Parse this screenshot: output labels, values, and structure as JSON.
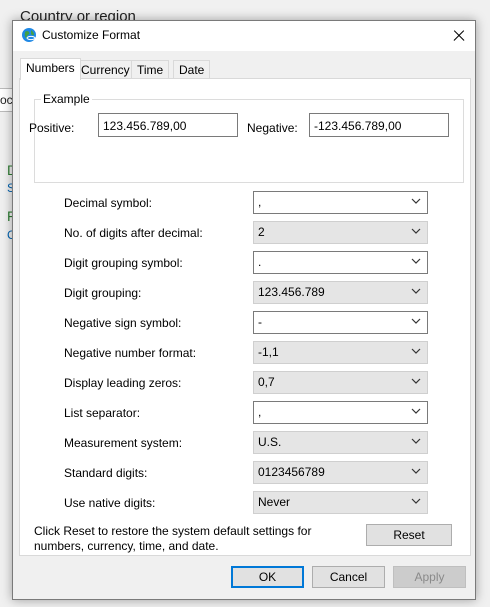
{
  "background": {
    "title": "Country or region",
    "strip_text": "oc",
    "green_1": "D",
    "blue_1": "S",
    "green_2": "F",
    "blue_2": "C"
  },
  "dialog": {
    "title": "Customize Format",
    "tabs": [
      {
        "label": "Numbers"
      },
      {
        "label": "Currency"
      },
      {
        "label": "Time"
      },
      {
        "label": "Date"
      }
    ],
    "example": {
      "group_label": "Example",
      "positive_label": "Positive:",
      "positive_value": "123.456.789,00",
      "negative_label": "Negative:",
      "negative_value": "-123.456.789,00"
    },
    "settings": [
      {
        "label": "Decimal symbol:",
        "value": ","
      },
      {
        "label": "No. of digits after decimal:",
        "value": "2"
      },
      {
        "label": "Digit grouping symbol:",
        "value": "."
      },
      {
        "label": "Digit grouping:",
        "value": "123.456.789"
      },
      {
        "label": "Negative sign symbol:",
        "value": "-"
      },
      {
        "label": "Negative number format:",
        "value": "-1,1"
      },
      {
        "label": "Display leading zeros:",
        "value": "0,7"
      },
      {
        "label": "List separator:",
        "value": ","
      },
      {
        "label": "Measurement system:",
        "value": "U.S."
      },
      {
        "label": "Standard digits:",
        "value": "0123456789"
      },
      {
        "label": "Use native digits:",
        "value": "Never"
      }
    ],
    "info_text": "Click Reset to restore the system default settings for numbers, currency, time, and date.",
    "reset_label": "Reset",
    "ok_label": "OK",
    "cancel_label": "Cancel",
    "apply_label": "Apply"
  },
  "colors": {
    "accent": "#0078d7",
    "icon_blue": "#1e88e5",
    "icon_green": "#43a047"
  },
  "icons": {
    "title": "globe-icon",
    "combo": "chevron-down-icon",
    "close": "close-icon"
  }
}
